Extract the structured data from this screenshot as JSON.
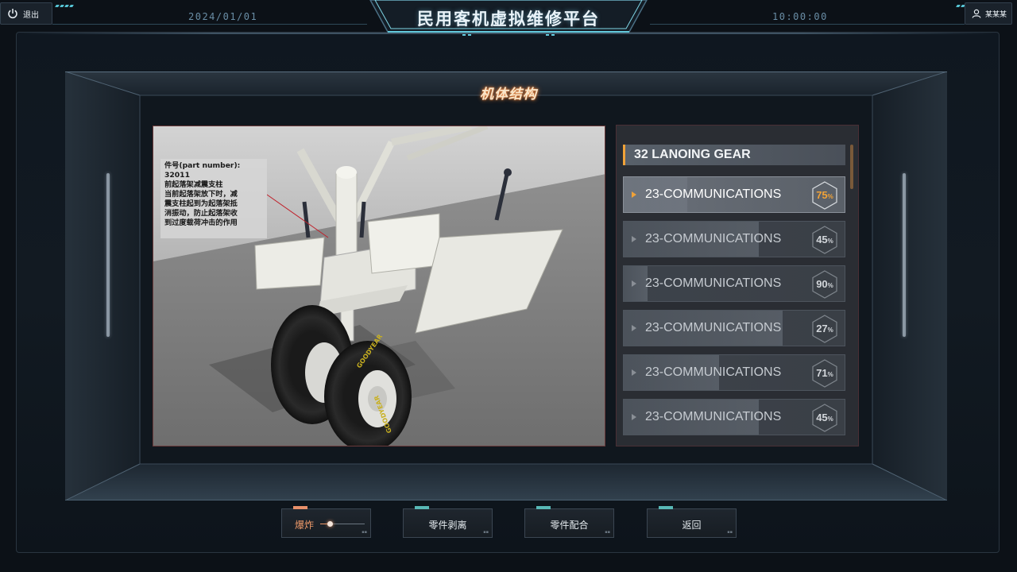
{
  "header": {
    "exit_label": "退出",
    "date": "2024/01/01",
    "title": "民用客机虚拟维修平台",
    "time": "10:00:00",
    "user_name": "某某某"
  },
  "section": {
    "title": "机体结构"
  },
  "annotation": {
    "line1": "件号(part number):",
    "line2": "32011",
    "line3": "前起落架减震支柱",
    "line4": "当前起落架放下时，减",
    "line5": "震支柱起到为起落架抵",
    "line6": "消振动，防止起落架收",
    "line7": "到过度载荷冲击的作用"
  },
  "panel": {
    "header": "32 LANOING GEAR",
    "items": [
      {
        "name": "23-COMMUNICATIONS",
        "percent": "75",
        "unit": "%",
        "active": true
      },
      {
        "name": "23-COMMUNICATIONS",
        "percent": "45",
        "unit": "%",
        "active": false
      },
      {
        "name": "23-COMMUNICATIONS",
        "percent": "90",
        "unit": "%",
        "active": false
      },
      {
        "name": "23-COMMUNICATIONS",
        "percent": "27",
        "unit": "%",
        "active": false
      },
      {
        "name": "23-COMMUNICATIONS",
        "percent": "71",
        "unit": "%",
        "active": false
      },
      {
        "name": "23-COMMUNICATIONS",
        "percent": "45",
        "unit": "%",
        "active": false
      }
    ]
  },
  "toolbar": {
    "explode_label": "爆炸",
    "strip_label": "零件剥离",
    "assemble_label": "零件配合",
    "back_label": "返回"
  },
  "colors": {
    "accent_orange": "#f0a238",
    "accent_teal": "#58b8b6",
    "active_button": "#ef9a6a"
  }
}
